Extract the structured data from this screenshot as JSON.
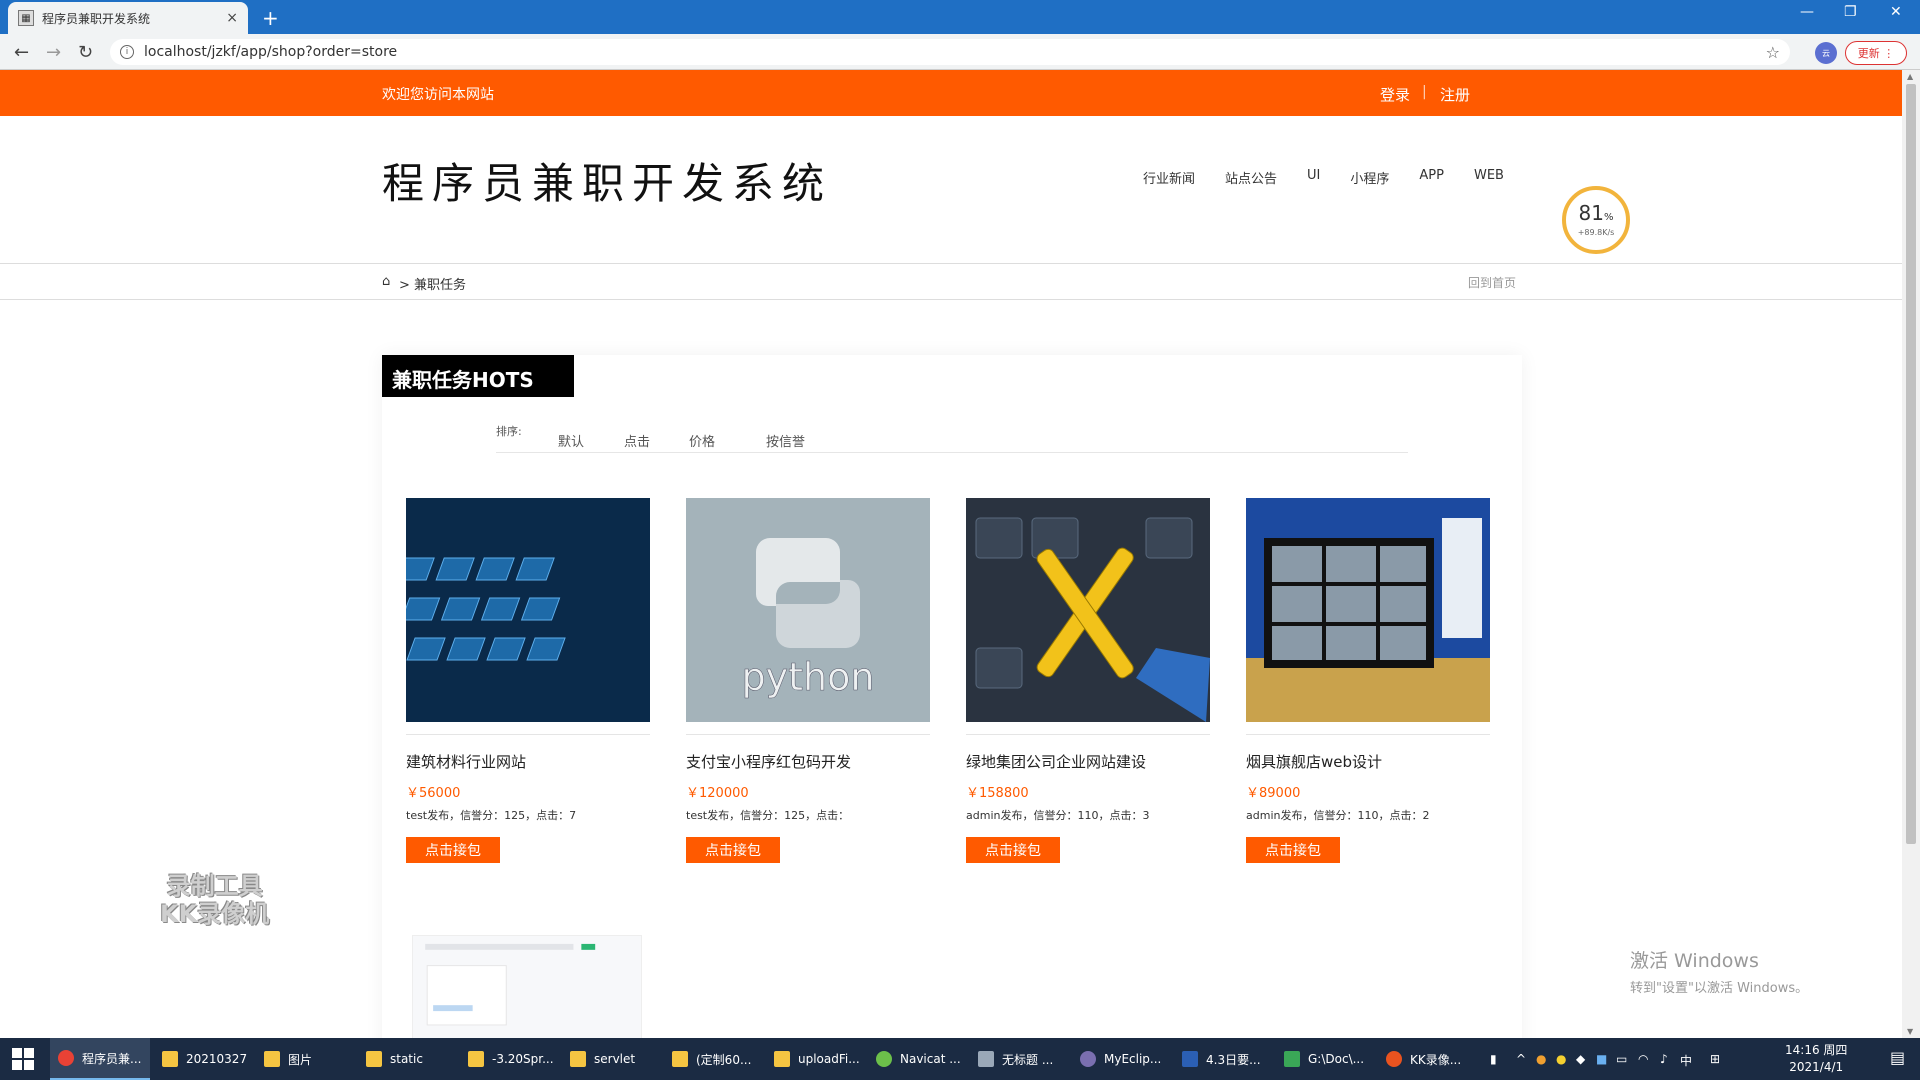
{
  "browser": {
    "tab_title": "程序员兼职开发系统",
    "tab_close": "×",
    "new_tab": "+",
    "url": "localhost/jzkf/app/shop?order=store",
    "profile_label": "云",
    "update_label": "更新"
  },
  "topbar": {
    "welcome": "欢迎您访问本网站",
    "login": "登录",
    "separator": "|",
    "register": "注册"
  },
  "header": {
    "site_title": "程序员兼职开发系统",
    "nav": [
      "行业新闻",
      "站点公告",
      "UI",
      "小程序",
      "APP",
      "WEB"
    ],
    "speed_gauge": {
      "percent": "81",
      "percent_unit": "%",
      "rate": "+89.8K/s"
    }
  },
  "breadcrumb": {
    "current": "> 兼职任务",
    "back_home": "回到首页"
  },
  "section": {
    "title": "兼职任务HOTS",
    "sort_label": "排序:",
    "sort_options": [
      "默认",
      "点击",
      "价格",
      "按信誉"
    ]
  },
  "tasks": [
    {
      "title": "建筑材料行业网站",
      "price": "￥56000",
      "meta": "test发布，信誉分：125，点击：7",
      "button": "点击接包",
      "image": "blue-keyboard"
    },
    {
      "title": "支付宝小程序红包码开发",
      "price": "￥120000",
      "meta": "test发布，信誉分：125，点击：",
      "button": "点击接包",
      "image": "python-logo"
    },
    {
      "title": "绿地集团公司企业网站建设",
      "price": "￥158800",
      "meta": "admin发布，信誉分：110，点击：3",
      "button": "点击接包",
      "image": "keyboard-tools"
    },
    {
      "title": "烟具旗舰店web设计",
      "price": "￥89000",
      "meta": "admin发布，信誉分：110，点击：2",
      "button": "点击接包",
      "image": "monitor-desk"
    }
  ],
  "overlay": {
    "recorder_line1": "录制工具",
    "recorder_line2": "KK录像机",
    "activate_line1": "激活 Windows",
    "activate_line2": "转到\"设置\"以激活 Windows。"
  },
  "taskbar": {
    "items": [
      "程序员兼...",
      "20210327",
      "图片",
      "static",
      "-3.20Spr...",
      "servlet",
      "(定制60...",
      "uploadFi...",
      "Navicat ...",
      "无标题 ...",
      "MyEclip...",
      "4.3日要...",
      "G:\\Doc\\...",
      "KK录像..."
    ],
    "ime": "中",
    "time": "14:16 周四",
    "date": "2021/4/1"
  },
  "colors": {
    "accent": "#ff5a00",
    "chrome": "#1f6fc4",
    "taskbar": "#1b2b43"
  }
}
